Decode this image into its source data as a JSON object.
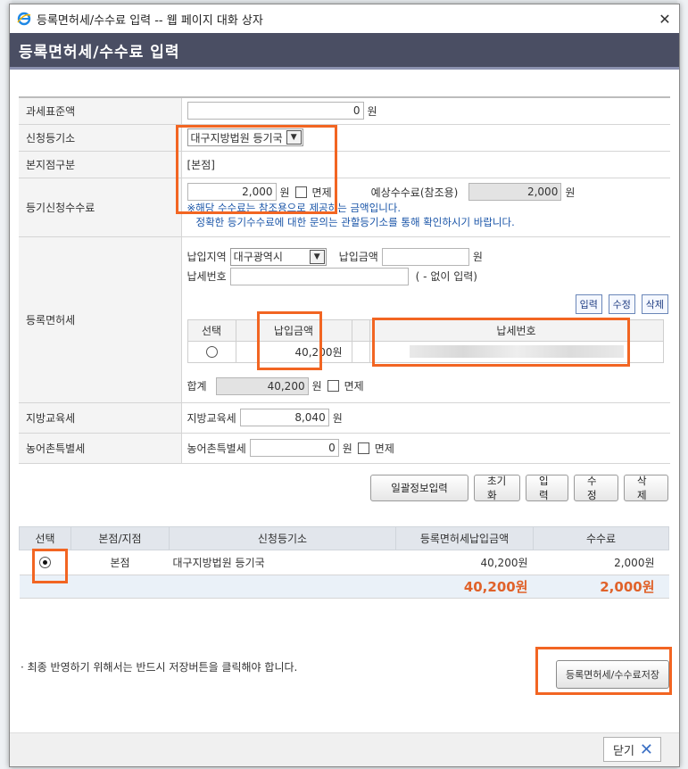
{
  "window": {
    "title": "등록면허세/수수료 입력 -- 웹 페이지 대화 상자"
  },
  "header": {
    "title": "등록면허세/수수료 입력"
  },
  "form": {
    "tax_base": {
      "label": "과세표준액",
      "value": "0",
      "unit": "원"
    },
    "registry": {
      "label": "신청등기소",
      "selected": "대구지방법원 등기국"
    },
    "branch": {
      "label": "본지점구분",
      "value": "[본점]"
    },
    "fee": {
      "label": "등기신청수수료",
      "value": "2,000",
      "unit": "원",
      "exempt_label": "면제",
      "expected_label": "예상수수료(참조용)",
      "expected_value": "2,000",
      "expected_unit": "원",
      "note1": "※해당 수수료는 참조용으로 제공하는 금액입니다.",
      "note2": "정확한 등기수수료에 대한 문의는 관할등기소를 통해 확인하시기 바랍니다."
    },
    "license_tax": {
      "label": "등록면허세",
      "region_label": "납입지역",
      "region_value": "대구광역시",
      "amount_label": "납입금액",
      "amount_value": "",
      "amount_unit": "원",
      "taxno_label": "납세번호",
      "taxno_hint": "( - 없이 입력)",
      "btn_input": "입력",
      "btn_edit": "수정",
      "btn_delete": "삭제",
      "columns": [
        "선택",
        "납입금액",
        "납세번호"
      ],
      "rows": [
        {
          "amount": "40,200원",
          "taxno": ""
        }
      ],
      "sum_label": "합계",
      "sum_value": "40,200",
      "sum_unit": "원",
      "exempt_label": "면제"
    },
    "edu_tax": {
      "label": "지방교육세",
      "inner_label": "지방교육세",
      "value": "8,040",
      "unit": "원"
    },
    "rural_tax": {
      "label": "농어촌특별세",
      "inner_label": "농어촌특별세",
      "value": "0",
      "unit": "원",
      "exempt_label": "면제"
    }
  },
  "actions": {
    "batch": "일괄정보입력",
    "reset": "초기화",
    "input": "입력",
    "edit": "수정",
    "delete": "삭제"
  },
  "list": {
    "columns": [
      "선택",
      "본점/지점",
      "신청등기소",
      "등록면허세납입금액",
      "수수료"
    ],
    "rows": [
      {
        "branch": "본점",
        "registry": "대구지방법원 등기국",
        "tax": "40,200원",
        "fee": "2,000원"
      }
    ],
    "total_tax": "40,200원",
    "total_fee": "2,000원"
  },
  "footer": {
    "note": "· 최종 반영하기 위해서는 반드시 저장버튼을 클릭해야 합니다.",
    "save_label": "등록면허세/수수료저장",
    "close_label": "닫기"
  },
  "colors": {
    "header": "#4a4e63",
    "highlight": "#f26522",
    "accent_total": "#e0622a"
  }
}
